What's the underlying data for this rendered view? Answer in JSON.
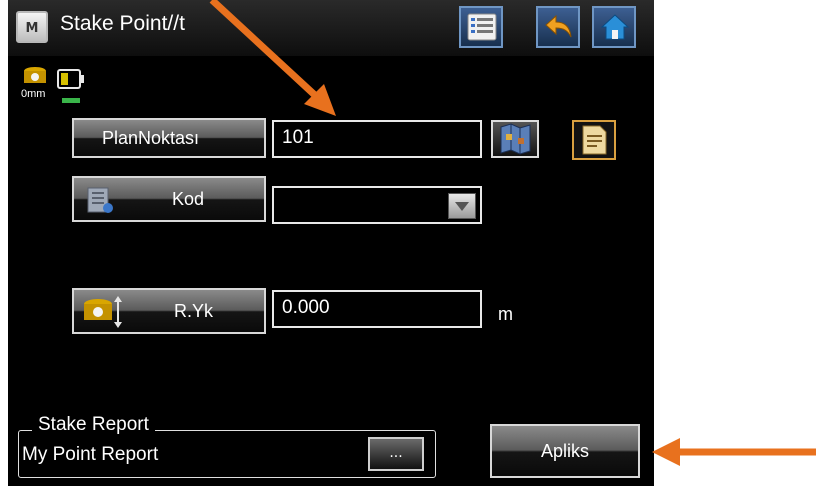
{
  "title_bar": {
    "mode_badge": "M",
    "title": "Stake Point//t",
    "icons": [
      "list-icon",
      "undo-arrow-icon",
      "home-icon"
    ]
  },
  "status": {
    "prism_height": "0mm",
    "icons": [
      "prism-icon",
      "battery-icon"
    ]
  },
  "point_row": {
    "button_label": "PlanNoktası",
    "value": "101",
    "icons": [
      "map-icon",
      "document-icon"
    ]
  },
  "code_row": {
    "button_label": "Kod",
    "value": "",
    "icons": [
      "code-list-icon",
      "dropdown-icon"
    ]
  },
  "height_row": {
    "button_label": "R.Yk",
    "value": "0.000",
    "unit": "m",
    "icons": [
      "prism-height-icon"
    ]
  },
  "report": {
    "legend": "Stake Report",
    "value": "My Point Report",
    "browse_label": "..."
  },
  "apply_button": {
    "label": "Apliks"
  },
  "colors": {
    "annotation_arrow": "#e8711e",
    "field_border": "#e8e8e8",
    "toolbar_button": "#2c4f80"
  }
}
